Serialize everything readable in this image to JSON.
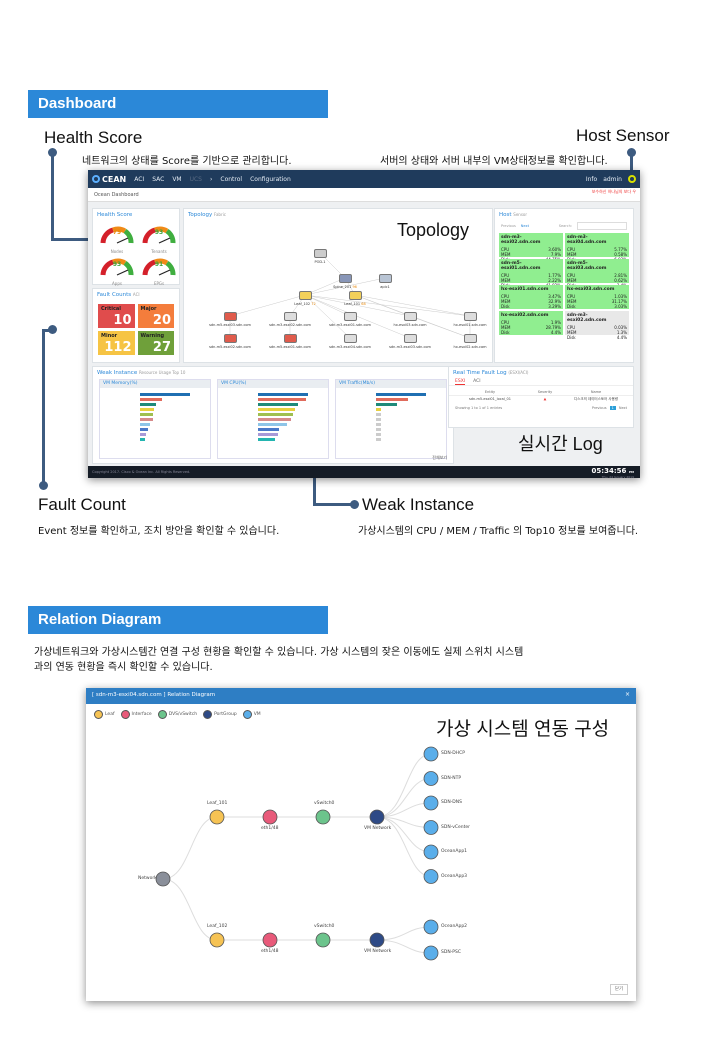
{
  "dashboard_section": {
    "banner": "Dashboard",
    "callouts": {
      "health_score": {
        "title": "Health Score",
        "desc": "네트워크의 상태를 Score를 기반으로 관리합니다."
      },
      "host_sensor": {
        "title": "Host Sensor",
        "desc": "서버의 상태와 서버 내부의 VM상태정보를 확인합니다."
      },
      "topology": {
        "title": "Topology"
      },
      "realtime_log": {
        "title": "실시간 Log"
      },
      "fault_count": {
        "title": "Fault Count",
        "desc": "Event 정보를 확인하고, 조치 방안을 확인할 수 있습니다."
      },
      "weak_instance": {
        "title": "Weak Instance",
        "desc": "가상시스템의 CPU / MEM / Traffic 의 Top10 정보를 보여줍니다."
      }
    },
    "app": {
      "logo": "CEAN",
      "nav": [
        "ACI",
        "SAC",
        "VM",
        "UCS"
      ],
      "menu": [
        "Control",
        "Configuration"
      ],
      "user_links": [
        "Info",
        "admin"
      ],
      "warning_note": "보수하신 하나님의 보다 우",
      "breadcrumb": "Ocean Dashboard",
      "health": {
        "title": "Health Score",
        "gauges": [
          {
            "label": "Nodes",
            "value": "79",
            "color": "#e8890c"
          },
          {
            "label": "Tenants",
            "value": "93",
            "color": "#3aa23a"
          },
          {
            "label": "Apps",
            "value": "93",
            "color": "#3aa23a"
          },
          {
            "label": "EPGs",
            "value": "91",
            "color": "#3aa23a"
          }
        ]
      },
      "faults": {
        "title": "Fault Counts",
        "subtitle": "ACI",
        "boxes": [
          {
            "label": "Critical",
            "value": "10",
            "color": "#e04c4c"
          },
          {
            "label": "Major",
            "value": "20",
            "color": "#f47d3c"
          },
          {
            "label": "Minor",
            "value": "112",
            "color": "#f6c444"
          },
          {
            "label": "Warning",
            "value": "27",
            "color": "#6fa03a"
          }
        ]
      },
      "topology": {
        "title": "Topology",
        "subtitle": "Fabric",
        "nodes": [
          {
            "label": "POD-1"
          },
          {
            "label": "Spine_201",
            "score": "96"
          },
          {
            "label": "apic1"
          },
          {
            "label": "Leaf_102",
            "score": "72"
          },
          {
            "label": "Leaf_101",
            "score": "68"
          },
          {
            "label": "sdn-m5-esxi03.sdn.com"
          },
          {
            "label": "sdn-m3-esxi02.sdn.com"
          },
          {
            "label": "sdn-m3-esxi01.sdn.com"
          },
          {
            "label": "hx-esxi03.sdn.com"
          },
          {
            "label": "hx-esxi01.sdn.com"
          },
          {
            "label": "sdn-m5-esxi02.sdn.com"
          },
          {
            "label": "sdn-m5-esxi01.sdn.com"
          },
          {
            "label": "sdn-m3-esxi04.sdn.com"
          },
          {
            "label": "sdn-m3-esxi03.sdn.com"
          },
          {
            "label": "hx-esxi02.sdn.com"
          }
        ]
      },
      "host": {
        "title": "Host",
        "subtitle": "Sensor",
        "pager": [
          "Previous",
          "Next"
        ],
        "search_label": "Search:",
        "cards": [
          {
            "name": "sdn-m3-esxi02.sdn.com",
            "cpu": "3.60%",
            "mem": "7.9%",
            "disk": "44.75%",
            "state": "ok"
          },
          {
            "name": "sdn-m3-esxi04.sdn.com",
            "cpu": "5.77%",
            "mem": "0.58%",
            "disk": "6.03%",
            "state": "ok"
          },
          {
            "name": "sdn-m5-esxi01.sdn.com",
            "cpu": "1.77%",
            "mem": "2.22%",
            "disk": "41.82%",
            "state": "ok"
          },
          {
            "name": "sdn-m5-esxi03.sdn.com",
            "cpu": "2.81%",
            "mem": "0.62%",
            "disk": "3.4%",
            "state": "ok"
          },
          {
            "name": "hx-esxi01.sdn.com",
            "cpu": "3.47%",
            "mem": "32.9%",
            "disk": "3.29%",
            "state": "ok"
          },
          {
            "name": "hx-esxi03.sdn.com",
            "cpu": "1.03%",
            "mem": "31.17%",
            "disk": "3.03%",
            "state": "ok"
          },
          {
            "name": "hx-esxi02.sdn.com",
            "cpu": "1.9%",
            "mem": "28.79%",
            "disk": "4.4%",
            "state": "ok"
          },
          {
            "name": "sdn-m3-esxi02.sdn.com",
            "cpu": "0.03%",
            "mem": "1.3%",
            "disk": "4.4%",
            "state": "off"
          }
        ]
      },
      "weak": {
        "title": "Weak Instance",
        "subtitle": "Resource Usage Top 10",
        "more_label": "전체보기",
        "charts": [
          {
            "title": "VM Memory(%)",
            "values": [
              48,
              21,
              15,
              13,
              12,
              12,
              10,
              8,
              6,
              5
            ],
            "colors": [
              "#1f6fb2",
              "#e06b5c",
              "#1f8a7a",
              "#e8d040",
              "#9fbf50",
              "#d68a8a",
              "#8ec5e8",
              "#4a78c8",
              "#a89ad8",
              "#24b5b0"
            ]
          },
          {
            "title": "VM CPU(%)",
            "values": [
              6.3,
              6.0,
              5.1,
              4.7,
              4.4,
              4.1,
              3.6,
              2.7,
              2.5,
              2.1
            ],
            "colors": [
              "#1f6fb2",
              "#e06b5c",
              "#1f8a7a",
              "#e8d040",
              "#9fbf50",
              "#d68a8a",
              "#8ec5e8",
              "#4a78c8",
              "#a89ad8",
              "#24b5b0"
            ]
          },
          {
            "title": "VM Traffic(Mb/s)",
            "values": [
              19,
              12,
              8,
              2,
              2,
              2,
              2,
              2,
              2,
              2
            ],
            "colors": [
              "#1f6fb2",
              "#e06b5c",
              "#1f8a7a",
              "#e8d040",
              "#ccc",
              "#ccc",
              "#ccc",
              "#ccc",
              "#ccc",
              "#ccc"
            ]
          }
        ]
      },
      "fault_log": {
        "title": "Real Time Fault Log",
        "subtitle": "(ESXI/ACI)",
        "tabs": [
          "ESXI",
          "ACI"
        ],
        "columns": [
          "Entity",
          "Severity",
          "Name"
        ],
        "rows": [
          {
            "entity": "sdn-m5-esxi01_local_01",
            "severity": "▲",
            "name": "디스크의 데이터스토어 사용량"
          }
        ],
        "info": "Showing 1 to 1 of 1 entries",
        "pager": [
          "Previous",
          "1",
          "Next"
        ]
      },
      "footer": {
        "copyright": "Copyright 2017. Cisco & Ocean Inc. All Rights Reserved.",
        "time": "05:34:56",
        "ampm": "PM",
        "date": "Thu, 24 January 2019"
      }
    }
  },
  "relation_section": {
    "banner": "Relation Diagram",
    "desc_line1": "가상네트워크와 가상시스템간 연결 구성 현황을 확인할 수 있습니다. 가상 시스템의 잦은 이동에도 실제 스위치 시스템",
    "desc_line2": "과의 연동 현황을 즉시 확인할 수 있습니다.",
    "overlay_title": "가상 시스템 연동 구성",
    "window_title": "[ sdn-m3-esxi04.sdn.com ] Relation Diagram",
    "close_x": "×",
    "legend": [
      {
        "label": "Leaf",
        "color": "#f6c354"
      },
      {
        "label": "Interface",
        "color": "#e85a7a"
      },
      {
        "label": "DVS/vSwitch",
        "color": "#6cc48c"
      },
      {
        "label": "PortGroup",
        "color": "#2e4a86"
      },
      {
        "label": "VM",
        "color": "#5aaeea"
      }
    ],
    "nodes": {
      "root": "Network",
      "branches": [
        {
          "leaf": "Leaf_101",
          "iface": "eth1/48",
          "vswitch": "vSwitch0",
          "portgroup": "VM Network",
          "vms": [
            "SDN-DHCP",
            "SDN-NTP",
            "SDN-DNS",
            "SDN-vCenter",
            "OceanApp1",
            "OceanApp3"
          ]
        },
        {
          "leaf": "Leaf_102",
          "iface": "eth1/48",
          "vswitch": "vSwitch0",
          "portgroup": "VM Network",
          "vms": [
            "OceanApp2",
            "SDN-PSC"
          ]
        }
      ]
    },
    "close_button": "닫기"
  }
}
